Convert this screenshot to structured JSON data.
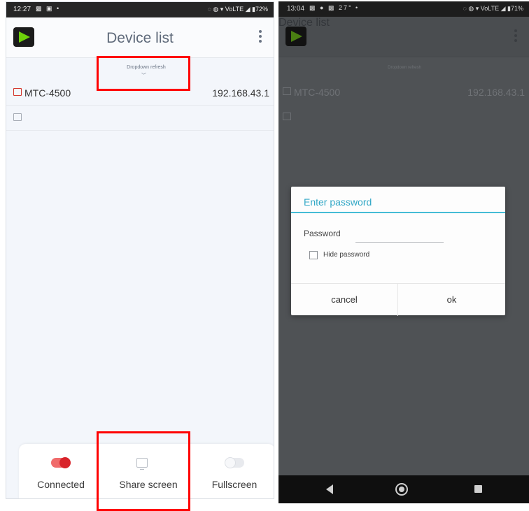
{
  "left": {
    "status": {
      "time": "12:27",
      "left_icons": "▩ ▣ •",
      "right_icons": "◌ ◍ ▾ VoLTE ◢ ▮72%"
    },
    "header": {
      "title": "Device list",
      "logo": "play-logo-icon",
      "menu_icon": "overflow-menu-icon"
    },
    "dropdown_hint": "Dropdown refresh",
    "devices": [
      {
        "name": "MTC-4500",
        "ip": "192.168.43.1",
        "icon": "device-icon"
      },
      {
        "name": "",
        "ip": "",
        "icon": "device-icon"
      }
    ],
    "bottom": {
      "connected_label": "Connected",
      "share_label": "Share screen",
      "fullscreen_label": "Fullscreen",
      "connected_on": true,
      "fullscreen_on": false
    }
  },
  "right": {
    "status": {
      "time": "13:04",
      "left_icons": "▩ ● ▩ 27° •",
      "right_icons": "◌ ◍ ▾ VoLTE ◢ ▮71%"
    },
    "header": {
      "title": "Device list"
    },
    "dropdown_hint": "Dropdown refresh",
    "devices": [
      {
        "name": "MTC-4500",
        "ip": "192.168.43.1"
      },
      {
        "name": "",
        "ip": ""
      }
    ],
    "dialog": {
      "title": "Enter password",
      "password_label": "Password",
      "password_value": "",
      "hide_password_label": "Hide password",
      "hide_password_checked": false,
      "cancel_label": "cancel",
      "ok_label": "ok"
    },
    "navbar": {
      "back": "back-icon",
      "home": "home-icon",
      "recents": "recents-icon"
    }
  },
  "colors": {
    "accent_red": "#d8232a",
    "dialog_accent": "#30a7c6",
    "highlight": "#ff0000"
  }
}
